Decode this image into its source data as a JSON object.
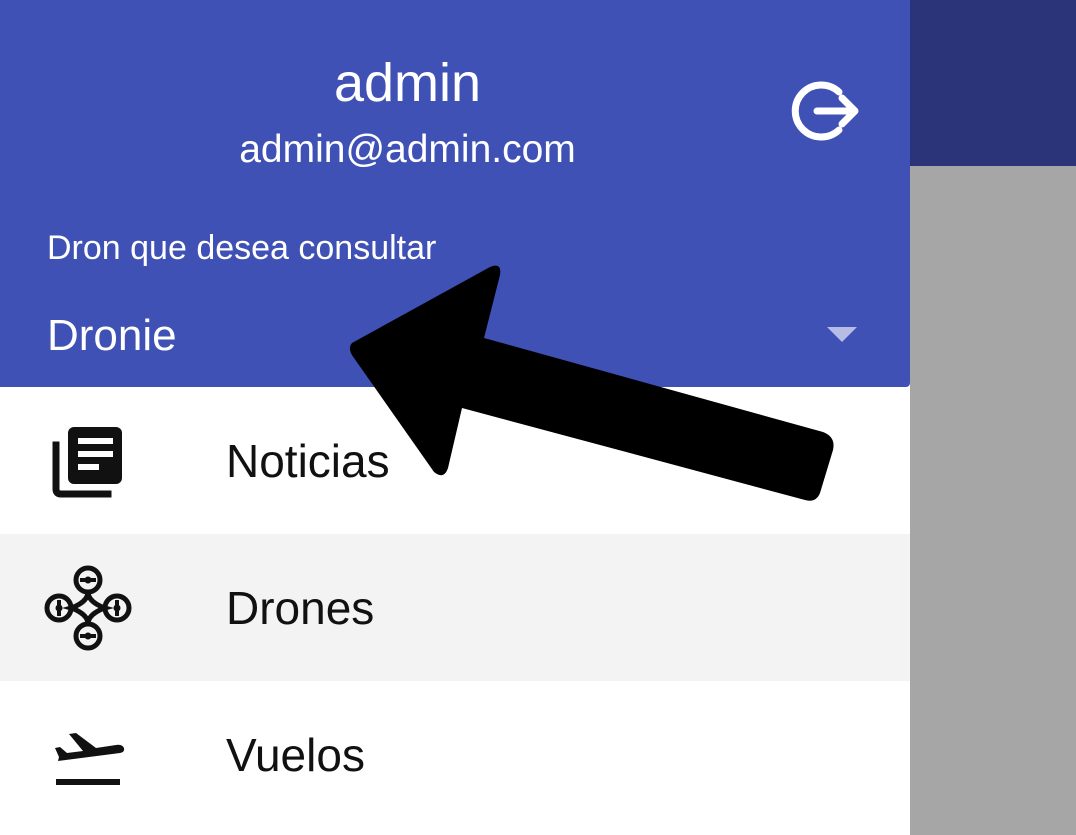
{
  "colors": {
    "header_bg": "#3f51b5",
    "appbar_bg": "#2c3479",
    "scrim": "#a6a6a6",
    "active_item_bg": "#f3f3f3",
    "text_dark": "#111111"
  },
  "header": {
    "user_name": "admin",
    "user_email": "admin@admin.com",
    "logout_icon": "logout-icon",
    "drone_select": {
      "label": "Dron que desea consultar",
      "selected_value": "Dronie"
    }
  },
  "nav": {
    "items": [
      {
        "label": "Noticias",
        "icon": "newspaper-icon",
        "active": false
      },
      {
        "label": "Drones",
        "icon": "drone-icon",
        "active": true
      },
      {
        "label": "Vuelos",
        "icon": "flight-takeoff-icon",
        "active": false
      }
    ]
  },
  "annotation": {
    "icon": "pointer-arrow-icon"
  }
}
